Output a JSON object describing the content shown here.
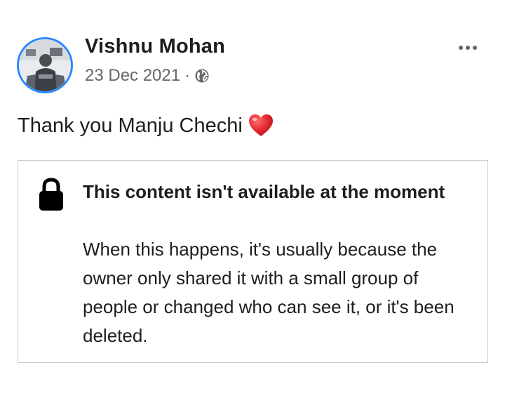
{
  "post": {
    "author": "Vishnu Mohan",
    "date": "23 Dec 2021",
    "separator": "·",
    "audience_icon": "globe-icon",
    "more_icon": "more-options-icon",
    "text": "Thank you Manju Chechi",
    "emoji": "heart-icon"
  },
  "unavailable": {
    "icon": "lock-icon",
    "title": "This content isn't available at the moment",
    "body": "When this happens, it's usually because the owner only shared it with a small group of people or changed who can see it, or it's been deleted."
  },
  "colors": {
    "avatar_ring": "#2d88ff",
    "meta_text": "#65676b",
    "heart": "#e0242b",
    "box_border": "#c9ccd1"
  }
}
